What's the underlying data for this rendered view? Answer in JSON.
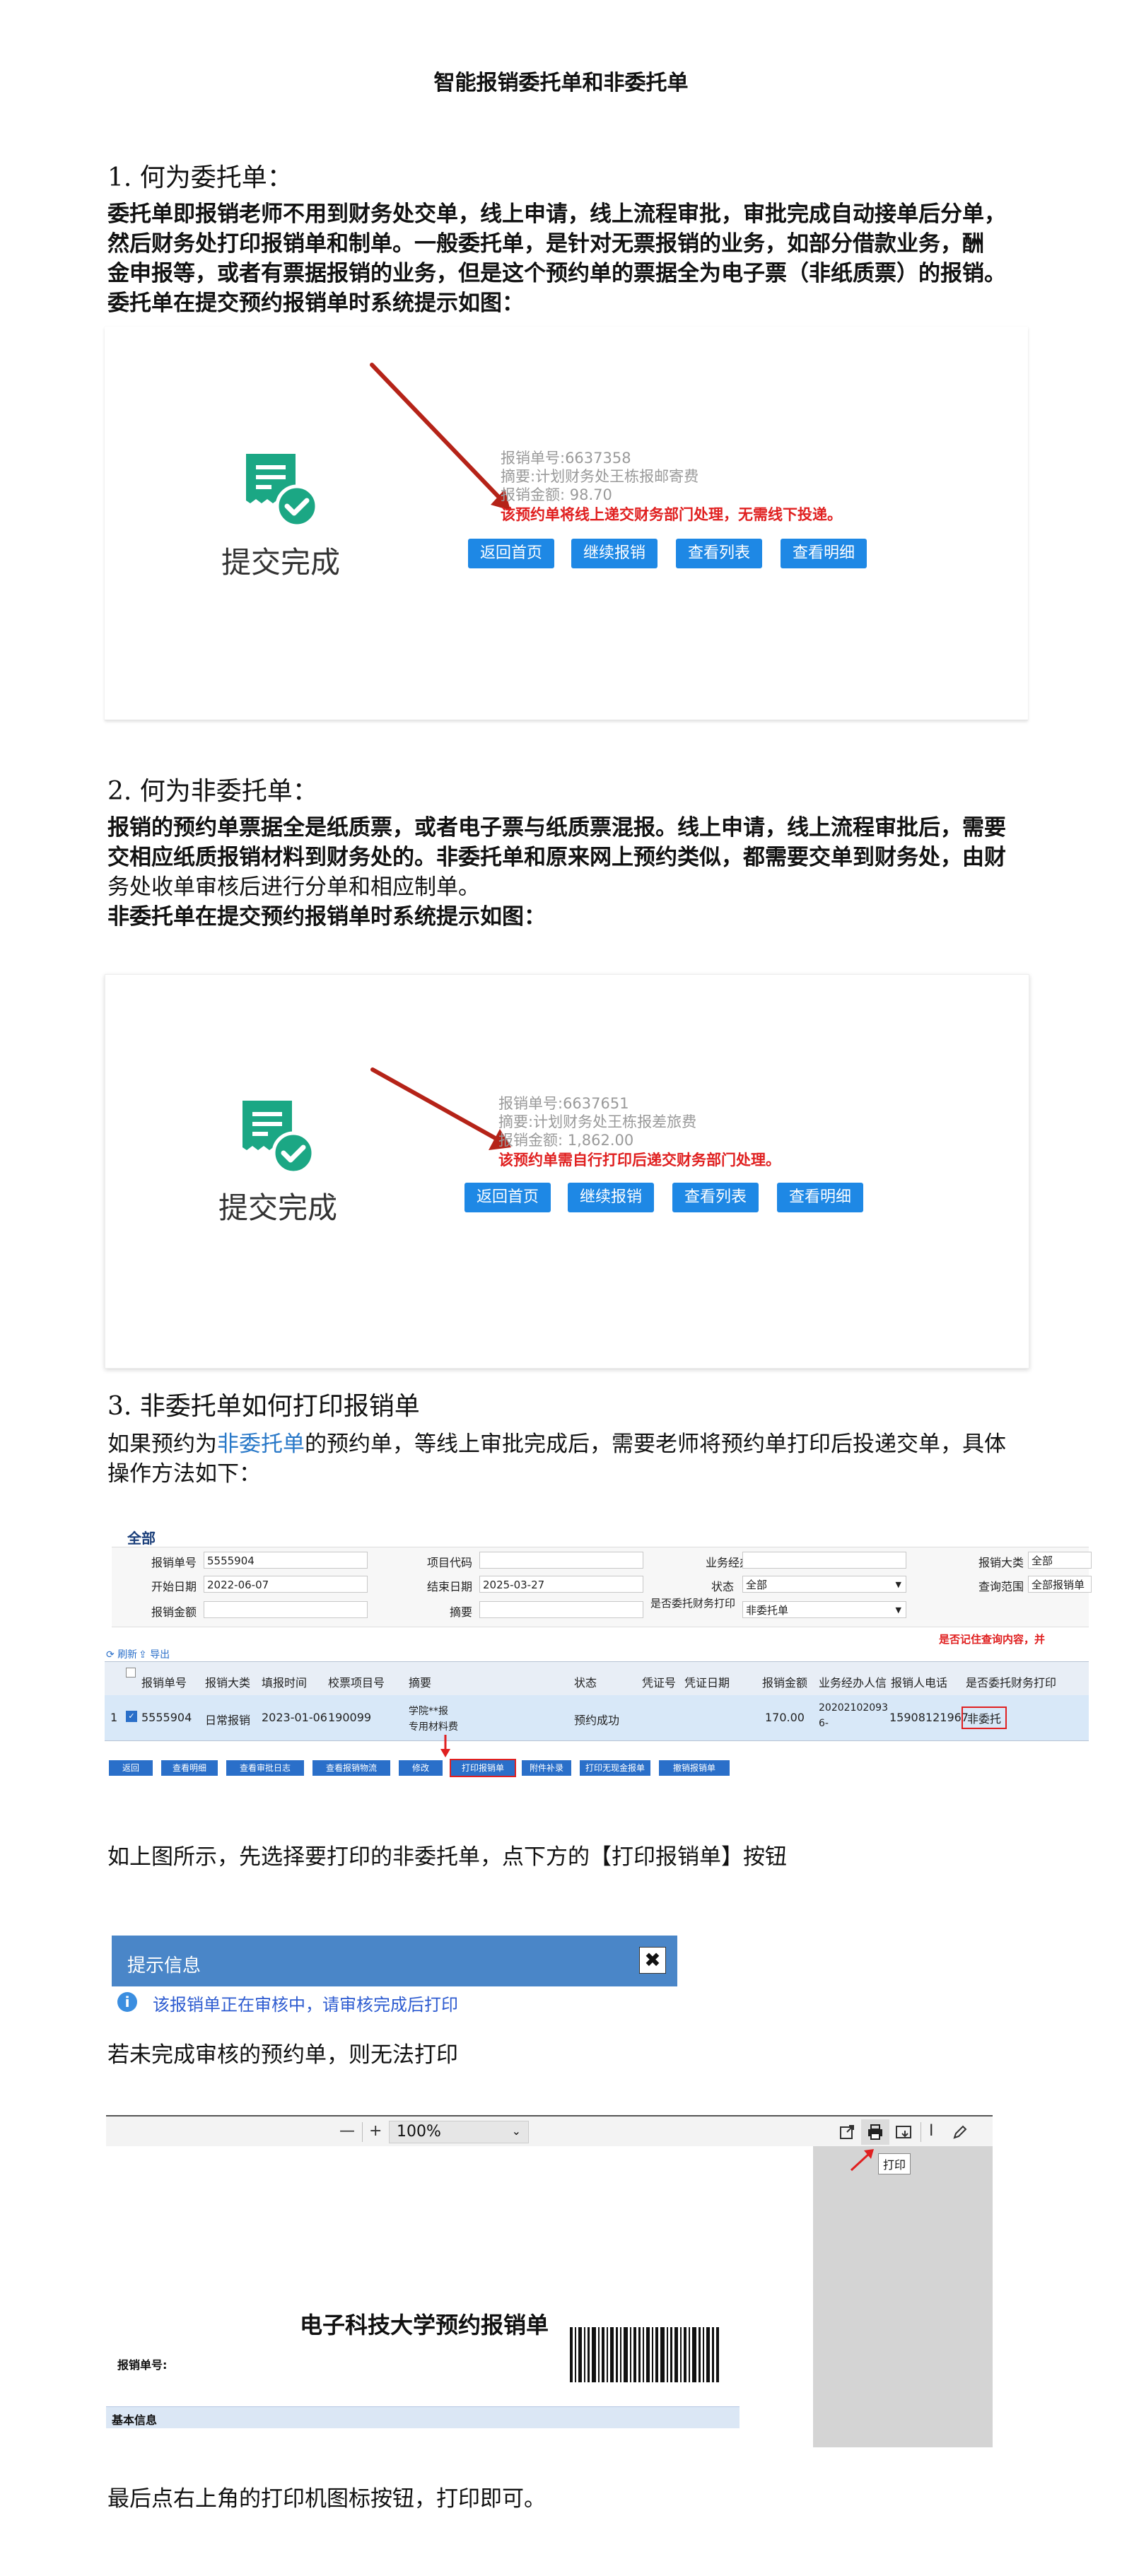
{
  "doc": {
    "title": "智能报销委托单和非委托单"
  },
  "sec1": {
    "heading": "1. 何为委托单：",
    "para_lines": [
      "委托单即报销老师不用到财务处交单，线上申请，线上流程审批，审批完成自动接单后分单，",
      "然后财务处打印报销单和制单。一般委托单，是针对无票报销的业务，如部分借款业务，酬",
      "金申报等，或者有票据报销的业务，但是这个预约单的票据全为电子票（非纸质票）的报销。",
      "委托单在提交预约报销单时系统提示如图："
    ]
  },
  "shot1": {
    "done_label": "提交完成",
    "info_lines": [
      "报销单号:6637358",
      "摘要:计划财务处王栋报邮寄费",
      "报销金额: 98.70"
    ],
    "warning": "该预约单将线上递交财务部门处理，无需线下投递。",
    "buttons": [
      "返回首页",
      "继续报销",
      "查看列表",
      "查看明细"
    ]
  },
  "sec2": {
    "heading": "2. 何为非委托单：",
    "para_lines": [
      "报销的预约单票据全是纸质票，或者电子票与纸质票混报。线上申请，线上流程审批后，需要",
      "交相应纸质报销材料到财务处的。非委托单和原来网上预约类似，都需要交单到财务处，由财",
      "务处收单审核后进行分单和相应制单。",
      "非委托单在提交预约报销单时系统提示如图："
    ]
  },
  "shot2": {
    "done_label": "提交完成",
    "info_lines": [
      "报销单号:6637651",
      "摘要:计划财务处王栋报差旅费",
      "报销金额: 1,862.00"
    ],
    "warning": "该预约单需自行打印后递交财务部门处理。",
    "buttons": [
      "返回首页",
      "继续报销",
      "查看列表",
      "查看明细"
    ]
  },
  "sec3": {
    "heading": "3. 非委托单如何打印报销单",
    "p1": "如果预约为",
    "p1_link": "非委托单",
    "p1_rest": "的预约单，等线上审批完成后，需要老师将预约单打印后投递交单，具体",
    "p2": "操作方法如下："
  },
  "sys": {
    "tab": "全部",
    "labels": {
      "no": "报销单号",
      "proj": "项目代码",
      "agent": "业务经办人",
      "cat": "报销大类",
      "start": "开始日期",
      "end": "结束日期",
      "status": "状态",
      "range": "查询范围",
      "amount": "报销金额",
      "summary": "摘要",
      "entrust": "是否委托财务打印"
    },
    "values": {
      "no": "5555904",
      "cat": "全部",
      "start": "2022-06-07",
      "end": "2025-03-27",
      "status": "全部",
      "range": "全部报销单",
      "entrust": "非委托单"
    },
    "remember_note": "是否记住查询内容，并",
    "refresh": "刷新",
    "export": "导出",
    "columns": [
      "报销单号",
      "报销大类",
      "填报时间",
      "校票项目号",
      "摘要",
      "状态",
      "凭证号",
      "凭证日期",
      "报销金额",
      "业务经办人信",
      "报销人电话",
      "是否委托财务打印"
    ],
    "row": {
      "idx": "1",
      "no": "5555904",
      "cat": "日常报销",
      "date": "2023-01-06",
      "proj": "190099",
      "summary_a": "学院**报",
      "summary_b": "专用材料费",
      "status": "预约成功",
      "amount": "170.00",
      "agent_a": "20202102093",
      "agent_b": "6-",
      "phone": "15908121967",
      "entrust": "非委托"
    },
    "toolbar": [
      "返回",
      "查看明细",
      "查看审批日志",
      "查看报销物流",
      "修改",
      "打印报销单",
      "附件补录",
      "打印无现金报单",
      "撤销报销单"
    ]
  },
  "step_text_1": "如上图所示，先选择要打印的非委托单，点下方的【打印报销单】按钮",
  "dialog": {
    "title": "提示信息",
    "close": "✖",
    "message": "该报销单正在审核中，请审核完成后打印"
  },
  "step_text_2": "若未完成审核的预约单，则无法打印",
  "pdf": {
    "minus": "—",
    "plus": "+",
    "zoom": "100%",
    "print_tooltip": "打印",
    "doc_title": "电子科技大学预约报销单",
    "no_label": "报销单号: ",
    "basic_info": "基本信息"
  },
  "final_text": "最后点右上角的打印机图标按钮，打印即可。",
  "colors": {
    "accent_blue": "#1e88e5",
    "warning_red": "#e02020",
    "icon_green": "#1ba784",
    "link_blue": "#2878c8",
    "dialog_blue": "#4a86c8"
  }
}
